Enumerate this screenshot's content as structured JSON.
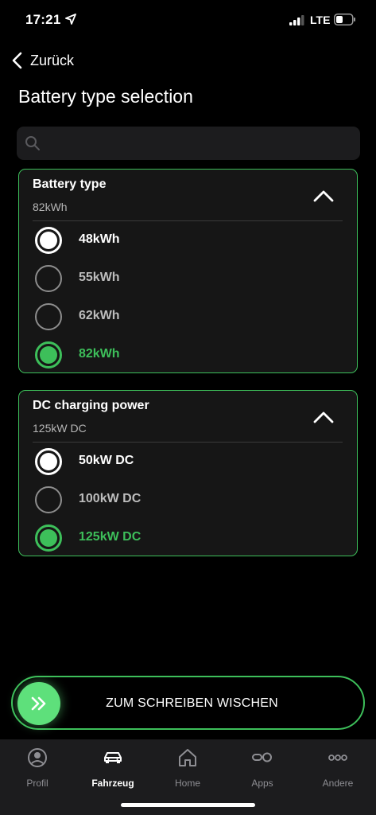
{
  "status_bar": {
    "time": "17:21",
    "network": "LTE",
    "icons": [
      "location-arrow-icon",
      "signal-icon",
      "battery-icon"
    ]
  },
  "nav": {
    "back_label": "Zurück",
    "title": "Battery type selection"
  },
  "search": {
    "placeholder": "",
    "value": ""
  },
  "battery_card": {
    "title": "Battery type",
    "subtitle": "82kWh",
    "options": [
      {
        "label": "48kWh",
        "state": "white"
      },
      {
        "label": "55kWh",
        "state": "none"
      },
      {
        "label": "62kWh",
        "state": "none"
      },
      {
        "label": "82kWh",
        "state": "selected"
      }
    ]
  },
  "dc_card": {
    "title": "DC charging power",
    "subtitle": "125kW DC",
    "options": [
      {
        "label": "50kW DC",
        "state": "white"
      },
      {
        "label": "100kW DC",
        "state": "none"
      },
      {
        "label": "125kW DC",
        "state": "selected"
      }
    ]
  },
  "swipe": {
    "label": "ZUM SCHREIBEN WISCHEN"
  },
  "tab_bar": {
    "active": "Fahrzeug",
    "tabs": [
      {
        "label": "Profil",
        "icon": "person-icon"
      },
      {
        "label": "Fahrzeug",
        "icon": "car-icon"
      },
      {
        "label": "Home",
        "icon": "home-icon"
      },
      {
        "label": "Apps",
        "icon": "apps-icon"
      },
      {
        "label": "Andere",
        "icon": "more-icon"
      }
    ]
  },
  "colors": {
    "accent": "#3dbf5a",
    "background": "#000000",
    "card": "#161616",
    "tab_bar": "#1c1c1e"
  }
}
